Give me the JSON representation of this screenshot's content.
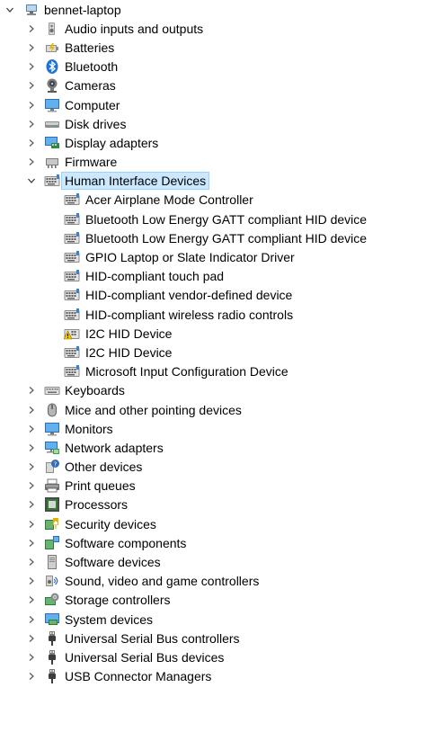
{
  "root": {
    "label": "bennet-laptop",
    "expanded": true,
    "icon": "computer-root-icon"
  },
  "categories": [
    {
      "label": "Audio inputs and outputs",
      "icon": "speaker-icon",
      "expanded": false
    },
    {
      "label": "Batteries",
      "icon": "battery-icon",
      "expanded": false
    },
    {
      "label": "Bluetooth",
      "icon": "bluetooth-icon",
      "expanded": false
    },
    {
      "label": "Cameras",
      "icon": "camera-icon",
      "expanded": false
    },
    {
      "label": "Computer",
      "icon": "monitor-icon",
      "expanded": false
    },
    {
      "label": "Disk drives",
      "icon": "disk-drive-icon",
      "expanded": false
    },
    {
      "label": "Display adapters",
      "icon": "display-adapter-icon",
      "expanded": false
    },
    {
      "label": "Firmware",
      "icon": "firmware-icon",
      "expanded": false
    },
    {
      "label": "Human Interface Devices",
      "icon": "hid-icon",
      "expanded": true,
      "selected": true,
      "children": [
        {
          "label": "Acer Airplane Mode Controller",
          "icon": "hid-icon"
        },
        {
          "label": "Bluetooth Low Energy GATT compliant HID device",
          "icon": "hid-icon"
        },
        {
          "label": "Bluetooth Low Energy GATT compliant HID device",
          "icon": "hid-icon"
        },
        {
          "label": "GPIO Laptop or Slate Indicator Driver",
          "icon": "hid-icon"
        },
        {
          "label": "HID-compliant touch pad",
          "icon": "hid-icon"
        },
        {
          "label": "HID-compliant vendor-defined device",
          "icon": "hid-icon"
        },
        {
          "label": "HID-compliant wireless radio controls",
          "icon": "hid-icon"
        },
        {
          "label": "I2C HID Device",
          "icon": "hid-warning-icon",
          "warning": true
        },
        {
          "label": "I2C HID Device",
          "icon": "hid-icon"
        },
        {
          "label": "Microsoft Input Configuration Device",
          "icon": "hid-icon"
        }
      ]
    },
    {
      "label": "Keyboards",
      "icon": "keyboard-icon",
      "expanded": false
    },
    {
      "label": "Mice and other pointing devices",
      "icon": "mouse-icon",
      "expanded": false
    },
    {
      "label": "Monitors",
      "icon": "monitor-icon",
      "expanded": false
    },
    {
      "label": "Network adapters",
      "icon": "network-adapter-icon",
      "expanded": false
    },
    {
      "label": "Other devices",
      "icon": "unknown-device-icon",
      "expanded": false
    },
    {
      "label": "Print queues",
      "icon": "printer-icon",
      "expanded": false
    },
    {
      "label": "Processors",
      "icon": "processor-icon",
      "expanded": false
    },
    {
      "label": "Security devices",
      "icon": "security-device-icon",
      "expanded": false
    },
    {
      "label": "Software components",
      "icon": "software-component-icon",
      "expanded": false
    },
    {
      "label": "Software devices",
      "icon": "software-device-icon",
      "expanded": false
    },
    {
      "label": "Sound, video and game controllers",
      "icon": "sound-controller-icon",
      "expanded": false
    },
    {
      "label": "Storage controllers",
      "icon": "storage-controller-icon",
      "expanded": false
    },
    {
      "label": "System devices",
      "icon": "system-device-icon",
      "expanded": false
    },
    {
      "label": "Universal Serial Bus controllers",
      "icon": "usb-icon",
      "expanded": false
    },
    {
      "label": "Universal Serial Bus devices",
      "icon": "usb-icon",
      "expanded": false
    },
    {
      "label": "USB Connector Managers",
      "icon": "usb-icon",
      "expanded": false
    }
  ],
  "colors": {
    "selection_bg": "#cce8ff",
    "selection_border": "#99d1ff",
    "chevron": "#5a5a5a",
    "warning": "#f5c400"
  }
}
